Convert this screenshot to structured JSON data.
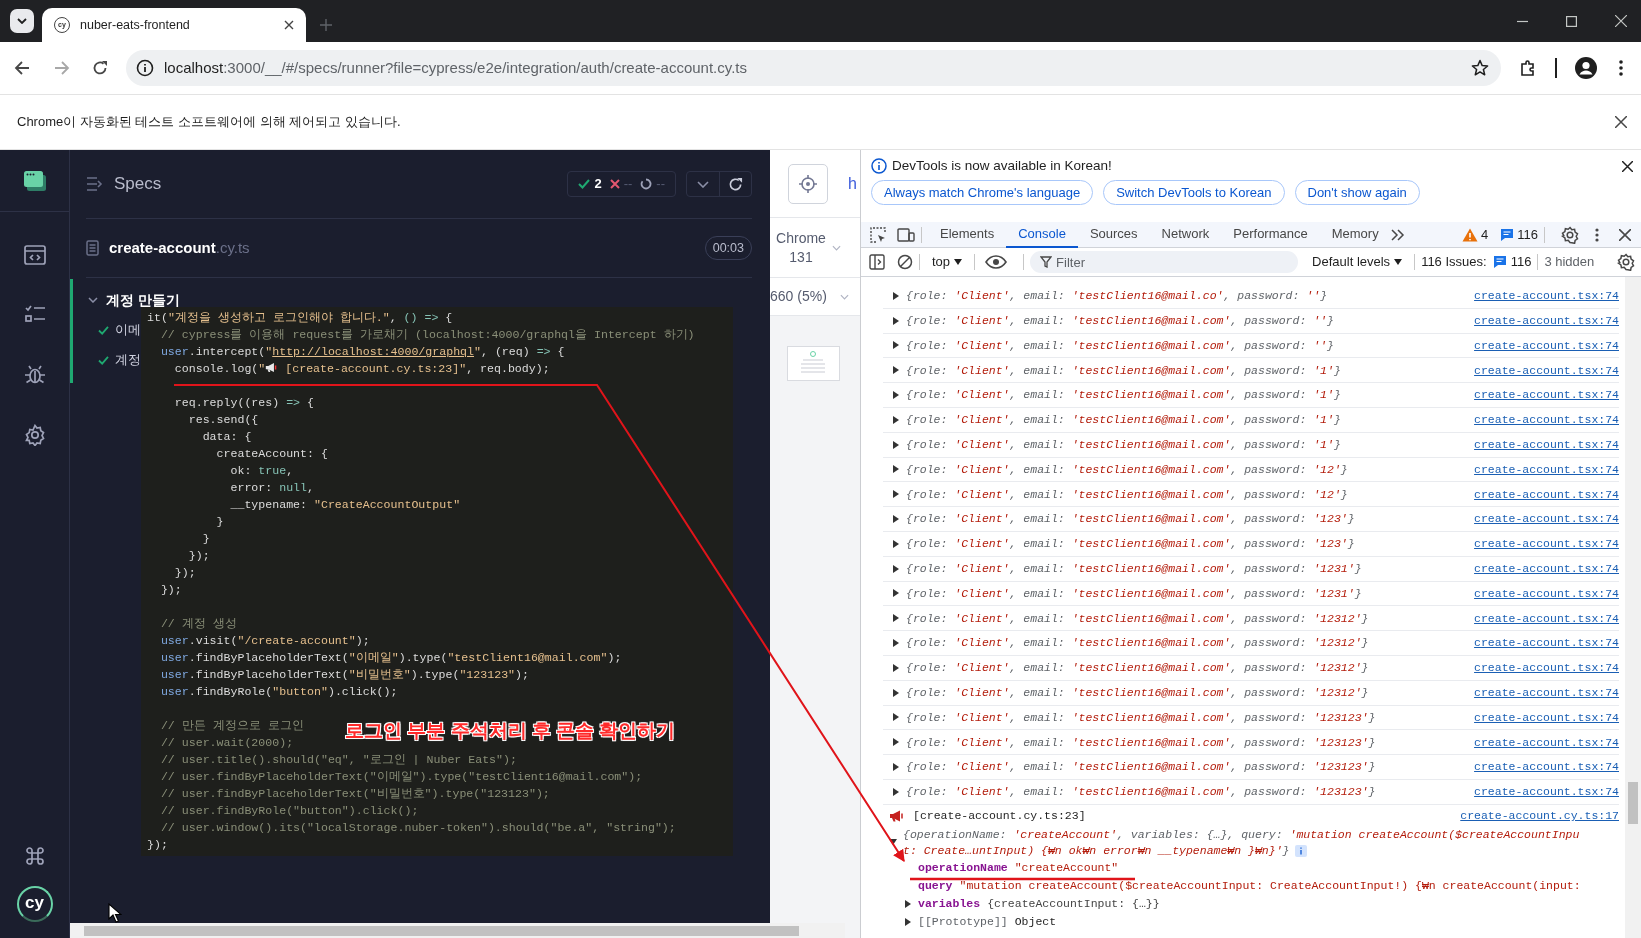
{
  "browser": {
    "favicon_text": "cy",
    "tab_title": "nuber-eats-frontend",
    "url_host": "localhost",
    "url_rest": ":3000/__/#/specs/runner?file=cypress/e2e/integration/auth/create-account.cy.ts",
    "infobar_text": "Chrome이 자동화된 테스트 소프트웨어에 의해 제어되고 있습니다."
  },
  "cypress": {
    "logo_text": "cy",
    "header_title": "Specs",
    "stats": [
      {
        "kind": "passed",
        "value": "2"
      },
      {
        "kind": "failed",
        "value": "--"
      },
      {
        "kind": "pending",
        "value": "--"
      }
    ],
    "spec": {
      "name": "create-account",
      "ext": ".cy.ts",
      "duration": "00:03"
    },
    "suite": {
      "title": "계정 만들기",
      "expanded": true,
      "tests": [
        {
          "title": "이메",
          "passed": true
        },
        {
          "title": "계정",
          "passed": true
        }
      ]
    }
  },
  "aut": {
    "url_fragment": "h",
    "browser": "Chrome 131",
    "viewport": "660 (5%)"
  },
  "code_overlay": {
    "lines": [
      {
        "kind": "code",
        "t": [
          {
            "kind": "plain",
            "text": "it("
          },
          {
            "kind": "string",
            "text": "\"계정을 생성하고 로그인해야 합니다.\""
          },
          {
            "kind": "plain",
            "text": ", "
          },
          {
            "kind": "literal",
            "text": "() =>"
          },
          {
            "kind": "plain",
            "text": " {"
          }
        ]
      },
      {
        "kind": "code",
        "t": [
          {
            "kind": "comment",
            "text": "  // cypress를 이용해 request를 가로채기 (localhost:4000/graphql을 Intercept 하기)"
          }
        ]
      },
      {
        "kind": "code",
        "t": [
          {
            "kind": "object",
            "text": "  user"
          },
          {
            "kind": "plain",
            "text": ".intercept("
          },
          {
            "kind": "string",
            "text": "\""
          },
          {
            "kind": "link",
            "text": "http://localhost:4000/graphql"
          },
          {
            "kind": "string",
            "text": "\""
          },
          {
            "kind": "plain",
            "text": ", (req) "
          },
          {
            "kind": "literal",
            "text": "=>"
          },
          {
            "kind": "plain",
            "text": " {"
          }
        ]
      },
      {
        "kind": "code",
        "t": [
          {
            "kind": "plain",
            "text": "    console.log("
          },
          {
            "kind": "string",
            "text": "\""
          },
          {
            "kind": "icon"
          },
          {
            "kind": "string",
            "text": " [create-account.cy.ts:23]\""
          },
          {
            "kind": "plain",
            "text": ", req.body);"
          }
        ]
      },
      {
        "kind": "blank"
      },
      {
        "kind": "code",
        "t": [
          {
            "kind": "plain",
            "text": "    req.reply((res) "
          },
          {
            "kind": "literal",
            "text": "=>"
          },
          {
            "kind": "plain",
            "text": " {"
          }
        ]
      },
      {
        "kind": "code",
        "t": [
          {
            "kind": "plain",
            "text": "      res.send({"
          }
        ]
      },
      {
        "kind": "code",
        "t": [
          {
            "kind": "plain",
            "text": "        data: {"
          }
        ]
      },
      {
        "kind": "code",
        "t": [
          {
            "kind": "plain",
            "text": "          createAccount: {"
          }
        ]
      },
      {
        "kind": "code",
        "t": [
          {
            "kind": "plain",
            "text": "            ok: "
          },
          {
            "kind": "literal",
            "text": "true"
          },
          {
            "kind": "plain",
            "text": ","
          }
        ]
      },
      {
        "kind": "code",
        "t": [
          {
            "kind": "plain",
            "text": "            error: "
          },
          {
            "kind": "literal",
            "text": "null"
          },
          {
            "kind": "plain",
            "text": ","
          }
        ]
      },
      {
        "kind": "code",
        "t": [
          {
            "kind": "plain",
            "text": "            __typename: "
          },
          {
            "kind": "string",
            "text": "\"CreateAccountOutput\""
          }
        ]
      },
      {
        "kind": "code",
        "t": [
          {
            "kind": "plain",
            "text": "          }"
          }
        ]
      },
      {
        "kind": "code",
        "t": [
          {
            "kind": "plain",
            "text": "        }"
          }
        ]
      },
      {
        "kind": "code",
        "t": [
          {
            "kind": "plain",
            "text": "      });"
          }
        ]
      },
      {
        "kind": "code",
        "t": [
          {
            "kind": "plain",
            "text": "    });"
          }
        ]
      },
      {
        "kind": "code",
        "t": [
          {
            "kind": "plain",
            "text": "  });"
          }
        ]
      },
      {
        "kind": "blank"
      },
      {
        "kind": "code",
        "t": [
          {
            "kind": "comment",
            "text": "  // 계정 생성"
          }
        ]
      },
      {
        "kind": "code",
        "t": [
          {
            "kind": "object",
            "text": "  user"
          },
          {
            "kind": "plain",
            "text": ".visit("
          },
          {
            "kind": "string",
            "text": "\"/create-account\""
          },
          {
            "kind": "plain",
            "text": ");"
          }
        ]
      },
      {
        "kind": "code",
        "t": [
          {
            "kind": "object",
            "text": "  user"
          },
          {
            "kind": "plain",
            "text": ".findByPlaceholderText("
          },
          {
            "kind": "string",
            "text": "\"이메일\""
          },
          {
            "kind": "plain",
            "text": ").type("
          },
          {
            "kind": "string",
            "text": "\"testClient16@mail.com\""
          },
          {
            "kind": "plain",
            "text": ");"
          }
        ]
      },
      {
        "kind": "code",
        "t": [
          {
            "kind": "object",
            "text": "  user"
          },
          {
            "kind": "plain",
            "text": ".findByPlaceholderText("
          },
          {
            "kind": "string",
            "text": "\"비밀번호\""
          },
          {
            "kind": "plain",
            "text": ").type("
          },
          {
            "kind": "string",
            "text": "\"123123\""
          },
          {
            "kind": "plain",
            "text": ");"
          }
        ]
      },
      {
        "kind": "code",
        "t": [
          {
            "kind": "object",
            "text": "  user"
          },
          {
            "kind": "plain",
            "text": ".findByRole("
          },
          {
            "kind": "string",
            "text": "\"button\""
          },
          {
            "kind": "plain",
            "text": ").click();"
          }
        ]
      },
      {
        "kind": "blank"
      },
      {
        "kind": "code",
        "t": [
          {
            "kind": "comment",
            "text": "  // 만든 계정으로 로그인"
          }
        ]
      },
      {
        "kind": "code",
        "t": [
          {
            "kind": "comment",
            "text": "  // user.wait(2000);"
          }
        ]
      },
      {
        "kind": "code",
        "t": [
          {
            "kind": "comment",
            "text": "  // user.title().should(\"eq\", \"로그인 | Nuber Eats\");"
          }
        ]
      },
      {
        "kind": "code",
        "t": [
          {
            "kind": "comment",
            "text": "  // user.findByPlaceholderText(\"이메일\").type(\"testClient16@mail.com\");"
          }
        ]
      },
      {
        "kind": "code",
        "t": [
          {
            "kind": "comment",
            "text": "  // user.findByPlaceholderText(\"비밀번호\").type(\"123123\");"
          }
        ]
      },
      {
        "kind": "code",
        "t": [
          {
            "kind": "comment",
            "text": "  // user.findByRole(\"button\").click();"
          }
        ]
      },
      {
        "kind": "code",
        "t": [
          {
            "kind": "comment",
            "text": "  // user.window().its(\"localStorage.nuber-token\").should(\"be.a\", \"string\");"
          }
        ]
      },
      {
        "kind": "code",
        "t": [
          {
            "kind": "plain",
            "text": "});"
          }
        ]
      }
    ],
    "annotation": "로그인 부분 주석처리 후 콘솔 확인하기"
  },
  "devtools": {
    "notice": "DevTools is now available in Korean!",
    "notice_buttons": [
      "Always match Chrome's language",
      "Switch DevTools to Korean",
      "Don't show again"
    ],
    "tabs": [
      {
        "label": "Elements",
        "selected": false
      },
      {
        "label": "Console",
        "selected": true
      },
      {
        "label": "Sources",
        "selected": false
      },
      {
        "label": "Network",
        "selected": false
      },
      {
        "label": "Performance",
        "selected": false
      },
      {
        "label": "Memory",
        "selected": false
      }
    ],
    "warnings": "4",
    "messages": "116",
    "context": "top",
    "filter_placeholder": "Filter",
    "levels": "Default levels",
    "issues_label": "116 Issues:",
    "issues_count": "116",
    "hidden": "3 hidden",
    "rows": [
      {
        "expanded": false,
        "preview": [
          {
            "kind": "key",
            "text": "{role: "
          },
          {
            "kind": "value",
            "text": "'Client'"
          },
          {
            "kind": "key",
            "text": ", email: "
          },
          {
            "kind": "value",
            "text": "'testClient16@mail.co'"
          },
          {
            "kind": "key",
            "text": ", password: "
          },
          {
            "kind": "value",
            "text": "''"
          },
          {
            "kind": "key",
            "text": "}"
          }
        ],
        "source": "create-account.tsx:74"
      },
      {
        "expanded": false,
        "preview": [
          {
            "kind": "key",
            "text": "{role: "
          },
          {
            "kind": "value",
            "text": "'Client'"
          },
          {
            "kind": "key",
            "text": ", email: "
          },
          {
            "kind": "value",
            "text": "'testClient16@mail.com'"
          },
          {
            "kind": "key",
            "text": ", password: "
          },
          {
            "kind": "value",
            "text": "''"
          },
          {
            "kind": "key",
            "text": "}"
          }
        ],
        "source": "create-account.tsx:74"
      },
      {
        "expanded": false,
        "preview": [
          {
            "kind": "key",
            "text": "{role: "
          },
          {
            "kind": "value",
            "text": "'Client'"
          },
          {
            "kind": "key",
            "text": ", email: "
          },
          {
            "kind": "value",
            "text": "'testClient16@mail.com'"
          },
          {
            "kind": "key",
            "text": ", password: "
          },
          {
            "kind": "value",
            "text": "''"
          },
          {
            "kind": "key",
            "text": "}"
          }
        ],
        "source": "create-account.tsx:74"
      },
      {
        "expanded": false,
        "preview": [
          {
            "kind": "key",
            "text": "{role: "
          },
          {
            "kind": "value",
            "text": "'Client'"
          },
          {
            "kind": "key",
            "text": ", email: "
          },
          {
            "kind": "value",
            "text": "'testClient16@mail.com'"
          },
          {
            "kind": "key",
            "text": ", password: "
          },
          {
            "kind": "value",
            "text": "'1'"
          },
          {
            "kind": "key",
            "text": "}"
          }
        ],
        "source": "create-account.tsx:74"
      },
      {
        "expanded": false,
        "preview": [
          {
            "kind": "key",
            "text": "{role: "
          },
          {
            "kind": "value",
            "text": "'Client'"
          },
          {
            "kind": "key",
            "text": ", email: "
          },
          {
            "kind": "value",
            "text": "'testClient16@mail.com'"
          },
          {
            "kind": "key",
            "text": ", password: "
          },
          {
            "kind": "value",
            "text": "'1'"
          },
          {
            "kind": "key",
            "text": "}"
          }
        ],
        "source": "create-account.tsx:74"
      },
      {
        "expanded": false,
        "preview": [
          {
            "kind": "key",
            "text": "{role: "
          },
          {
            "kind": "value",
            "text": "'Client'"
          },
          {
            "kind": "key",
            "text": ", email: "
          },
          {
            "kind": "value",
            "text": "'testClient16@mail.com'"
          },
          {
            "kind": "key",
            "text": ", password: "
          },
          {
            "kind": "value",
            "text": "'1'"
          },
          {
            "kind": "key",
            "text": "}"
          }
        ],
        "source": "create-account.tsx:74"
      },
      {
        "expanded": false,
        "preview": [
          {
            "kind": "key",
            "text": "{role: "
          },
          {
            "kind": "value",
            "text": "'Client'"
          },
          {
            "kind": "key",
            "text": ", email: "
          },
          {
            "kind": "value",
            "text": "'testClient16@mail.com'"
          },
          {
            "kind": "key",
            "text": ", password: "
          },
          {
            "kind": "value",
            "text": "'1'"
          },
          {
            "kind": "key",
            "text": "}"
          }
        ],
        "source": "create-account.tsx:74"
      },
      {
        "expanded": false,
        "preview": [
          {
            "kind": "key",
            "text": "{role: "
          },
          {
            "kind": "value",
            "text": "'Client'"
          },
          {
            "kind": "key",
            "text": ", email: "
          },
          {
            "kind": "value",
            "text": "'testClient16@mail.com'"
          },
          {
            "kind": "key",
            "text": ", password: "
          },
          {
            "kind": "value",
            "text": "'12'"
          },
          {
            "kind": "key",
            "text": "}"
          }
        ],
        "source": "create-account.tsx:74"
      },
      {
        "expanded": false,
        "preview": [
          {
            "kind": "key",
            "text": "{role: "
          },
          {
            "kind": "value",
            "text": "'Client'"
          },
          {
            "kind": "key",
            "text": ", email: "
          },
          {
            "kind": "value",
            "text": "'testClient16@mail.com'"
          },
          {
            "kind": "key",
            "text": ", password: "
          },
          {
            "kind": "value",
            "text": "'12'"
          },
          {
            "kind": "key",
            "text": "}"
          }
        ],
        "source": "create-account.tsx:74"
      },
      {
        "expanded": false,
        "preview": [
          {
            "kind": "key",
            "text": "{role: "
          },
          {
            "kind": "value",
            "text": "'Client'"
          },
          {
            "kind": "key",
            "text": ", email: "
          },
          {
            "kind": "value",
            "text": "'testClient16@mail.com'"
          },
          {
            "kind": "key",
            "text": ", password: "
          },
          {
            "kind": "value",
            "text": "'123'"
          },
          {
            "kind": "key",
            "text": "}"
          }
        ],
        "source": "create-account.tsx:74"
      },
      {
        "expanded": false,
        "preview": [
          {
            "kind": "key",
            "text": "{role: "
          },
          {
            "kind": "value",
            "text": "'Client'"
          },
          {
            "kind": "key",
            "text": ", email: "
          },
          {
            "kind": "value",
            "text": "'testClient16@mail.com'"
          },
          {
            "kind": "key",
            "text": ", password: "
          },
          {
            "kind": "value",
            "text": "'123'"
          },
          {
            "kind": "key",
            "text": "}"
          }
        ],
        "source": "create-account.tsx:74"
      },
      {
        "expanded": false,
        "preview": [
          {
            "kind": "key",
            "text": "{role: "
          },
          {
            "kind": "value",
            "text": "'Client'"
          },
          {
            "kind": "key",
            "text": ", email: "
          },
          {
            "kind": "value",
            "text": "'testClient16@mail.com'"
          },
          {
            "kind": "key",
            "text": ", password: "
          },
          {
            "kind": "value",
            "text": "'1231'"
          },
          {
            "kind": "key",
            "text": "}"
          }
        ],
        "source": "create-account.tsx:74"
      },
      {
        "expanded": false,
        "preview": [
          {
            "kind": "key",
            "text": "{role: "
          },
          {
            "kind": "value",
            "text": "'Client'"
          },
          {
            "kind": "key",
            "text": ", email: "
          },
          {
            "kind": "value",
            "text": "'testClient16@mail.com'"
          },
          {
            "kind": "key",
            "text": ", password: "
          },
          {
            "kind": "value",
            "text": "'1231'"
          },
          {
            "kind": "key",
            "text": "}"
          }
        ],
        "source": "create-account.tsx:74"
      },
      {
        "expanded": false,
        "preview": [
          {
            "kind": "key",
            "text": "{role: "
          },
          {
            "kind": "value",
            "text": "'Client'"
          },
          {
            "kind": "key",
            "text": ", email: "
          },
          {
            "kind": "value",
            "text": "'testClient16@mail.com'"
          },
          {
            "kind": "key",
            "text": ", password: "
          },
          {
            "kind": "value",
            "text": "'12312'"
          },
          {
            "kind": "key",
            "text": "}"
          }
        ],
        "source": "create-account.tsx:74"
      },
      {
        "expanded": false,
        "preview": [
          {
            "kind": "key",
            "text": "{role: "
          },
          {
            "kind": "value",
            "text": "'Client'"
          },
          {
            "kind": "key",
            "text": ", email: "
          },
          {
            "kind": "value",
            "text": "'testClient16@mail.com'"
          },
          {
            "kind": "key",
            "text": ", password: "
          },
          {
            "kind": "value",
            "text": "'12312'"
          },
          {
            "kind": "key",
            "text": "}"
          }
        ],
        "source": "create-account.tsx:74"
      },
      {
        "expanded": false,
        "preview": [
          {
            "kind": "key",
            "text": "{role: "
          },
          {
            "kind": "value",
            "text": "'Client'"
          },
          {
            "kind": "key",
            "text": ", email: "
          },
          {
            "kind": "value",
            "text": "'testClient16@mail.com'"
          },
          {
            "kind": "key",
            "text": ", password: "
          },
          {
            "kind": "value",
            "text": "'12312'"
          },
          {
            "kind": "key",
            "text": "}"
          }
        ],
        "source": "create-account.tsx:74"
      },
      {
        "expanded": false,
        "preview": [
          {
            "kind": "key",
            "text": "{role: "
          },
          {
            "kind": "value",
            "text": "'Client'"
          },
          {
            "kind": "key",
            "text": ", email: "
          },
          {
            "kind": "value",
            "text": "'testClient16@mail.com'"
          },
          {
            "kind": "key",
            "text": ", password: "
          },
          {
            "kind": "value",
            "text": "'12312'"
          },
          {
            "kind": "key",
            "text": "}"
          }
        ],
        "source": "create-account.tsx:74"
      },
      {
        "expanded": false,
        "preview": [
          {
            "kind": "key",
            "text": "{role: "
          },
          {
            "kind": "value",
            "text": "'Client'"
          },
          {
            "kind": "key",
            "text": ", email: "
          },
          {
            "kind": "value",
            "text": "'testClient16@mail.com'"
          },
          {
            "kind": "key",
            "text": ", password: "
          },
          {
            "kind": "value",
            "text": "'123123'"
          },
          {
            "kind": "key",
            "text": "}"
          }
        ],
        "source": "create-account.tsx:74"
      },
      {
        "expanded": false,
        "preview": [
          {
            "kind": "key",
            "text": "{role: "
          },
          {
            "kind": "value",
            "text": "'Client'"
          },
          {
            "kind": "key",
            "text": ", email: "
          },
          {
            "kind": "value",
            "text": "'testClient16@mail.com'"
          },
          {
            "kind": "key",
            "text": ", password: "
          },
          {
            "kind": "value",
            "text": "'123123'"
          },
          {
            "kind": "key",
            "text": "}"
          }
        ],
        "source": "create-account.tsx:74"
      },
      {
        "expanded": false,
        "preview": [
          {
            "kind": "key",
            "text": "{role: "
          },
          {
            "kind": "value",
            "text": "'Client'"
          },
          {
            "kind": "key",
            "text": ", email: "
          },
          {
            "kind": "value",
            "text": "'testClient16@mail.com'"
          },
          {
            "kind": "key",
            "text": ", password: "
          },
          {
            "kind": "value",
            "text": "'123123'"
          },
          {
            "kind": "key",
            "text": "}"
          }
        ],
        "source": "create-account.tsx:74"
      },
      {
        "expanded": false,
        "preview": [
          {
            "kind": "key",
            "text": "{role: "
          },
          {
            "kind": "value",
            "text": "'Client'"
          },
          {
            "kind": "key",
            "text": ", email: "
          },
          {
            "kind": "value",
            "text": "'testClient16@mail.com'"
          },
          {
            "kind": "key",
            "text": ", password: "
          },
          {
            "kind": "value",
            "text": "'123123'"
          },
          {
            "kind": "key",
            "text": "}"
          }
        ],
        "source": "create-account.tsx:74"
      }
    ],
    "group": {
      "label": "[create-account.cy.ts:23]",
      "source": "create-account.cy.ts:17",
      "expanded": true,
      "preview": [
        {
          "kind": "key",
          "text": "{operationName: "
        },
        {
          "kind": "value",
          "text": "'createAccount'"
        },
        {
          "kind": "key",
          "text": ", variables: {…}, query: "
        },
        {
          "kind": "value",
          "text": "'mutation createAccount($createAccountInput: Create…untInput) {₩n    ok₩n    error₩n    __typename₩n  }₩n}'"
        },
        {
          "kind": "key",
          "text": "}"
        }
      ],
      "props": [
        {
          "kind": "string",
          "key": "operationName",
          "value": "\"createAccount\""
        },
        {
          "kind": "string",
          "key": "query",
          "value": "\"mutation createAccount($createAccountInput: CreateAccountInput!) {₩n  createAccount(input:"
        },
        {
          "kind": "object",
          "key": "variables",
          "value": "{createAccountInput: {…}}",
          "expanded": false
        },
        {
          "kind": "internal",
          "key": "[[Prototype]]",
          "value": "Object",
          "expanded": false
        }
      ]
    }
  }
}
